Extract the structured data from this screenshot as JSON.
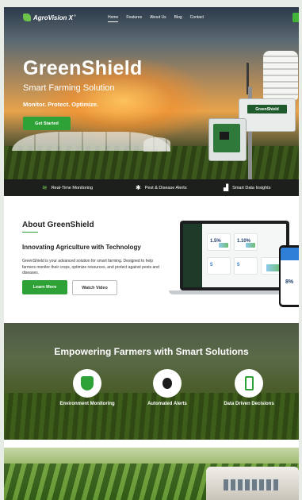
{
  "nav": {
    "brand": "AgroVision X",
    "brand_mark": "°",
    "links": [
      "Home",
      "Features",
      "About Us",
      "Blog",
      "Contact"
    ]
  },
  "hero": {
    "title": "GreenShield",
    "subtitle": "Smart Farming Solution",
    "tagline": "Monitor. Protect. Optimize.",
    "cta": "Get Started",
    "device_label": "GreenShield"
  },
  "features_strip": [
    {
      "icon": "wifi-icon",
      "glyph": "≋",
      "label": "Real-Time Monitoring"
    },
    {
      "icon": "bug-icon",
      "glyph": "✱",
      "label": "Pest & Disease Alerts"
    },
    {
      "icon": "bar-chart-icon",
      "glyph": "▟",
      "label": "Smart Data Insights"
    }
  ],
  "about": {
    "title": "About GreenShield",
    "subtitle": "Innovating Agriculture with Technology",
    "body": "GreenShield is your advanced solution for smart farming. Designed to help farmers monitor their crops, optimize resources, and protect against pests and diseases.",
    "learn_more": "Learn More",
    "watch_video": "Watch Video",
    "dashboard_values": [
      "1.5%",
      "1.10%",
      "5",
      "5"
    ],
    "phone_value": "8%"
  },
  "empower": {
    "title": "Empowering Farmers with Smart Solutions",
    "items": [
      {
        "icon": "shield-leaf-icon",
        "label": "Environment Monitoring"
      },
      {
        "icon": "bug-icon",
        "label": "Automated Alerts"
      },
      {
        "icon": "smartphone-icon",
        "label": "Data Driven Decisions"
      }
    ]
  },
  "colors": {
    "accent": "#2ea236",
    "strip_bg": "#1d1f1d"
  }
}
